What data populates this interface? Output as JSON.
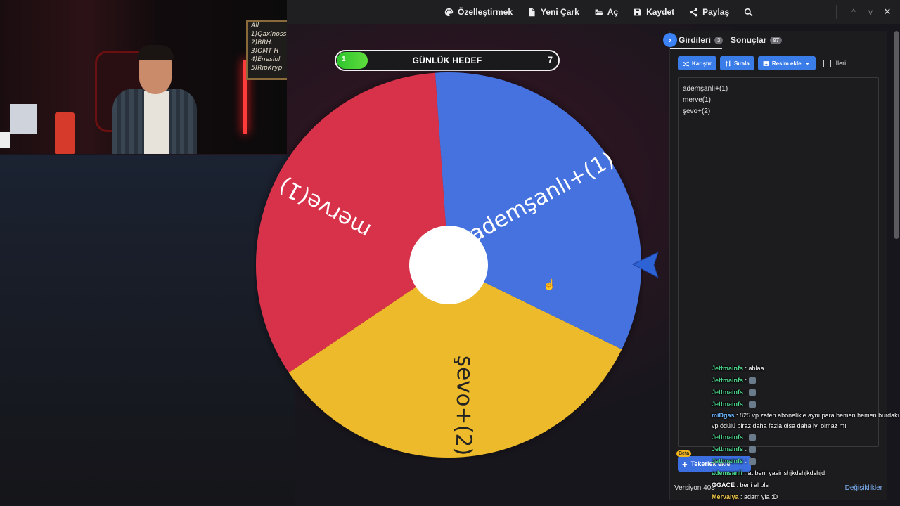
{
  "toolbar": {
    "items": [
      {
        "label": "Özelleştirmek",
        "icon": "palette-icon"
      },
      {
        "label": "Yeni Çark",
        "icon": "file-icon"
      },
      {
        "label": "Aç",
        "icon": "folder-open-icon"
      },
      {
        "label": "Kaydet",
        "icon": "save-icon"
      },
      {
        "label": "Paylaş",
        "icon": "share-icon"
      }
    ],
    "search_icon": "search-icon",
    "window_controls": [
      "^",
      "v",
      "✕"
    ]
  },
  "webcam": {
    "board_lines": [
      "All",
      "1)Qaxinoss",
      "2)BRH...",
      "3)OMT H",
      "4)Eneslol",
      "5)RipKryp"
    ]
  },
  "goal": {
    "current": "1",
    "title": "GÜNLÜK HEDEF",
    "target": "7",
    "progress": 0.14
  },
  "wheel": {
    "segments": [
      {
        "label": "ademşanlı+(1)",
        "color": "#4472df"
      },
      {
        "label": "şevo+(2)",
        "color": "#ecba2a"
      },
      {
        "label": "merve(1)",
        "color": "#d8334c"
      }
    ]
  },
  "panel": {
    "tab_inputs": "Girdileri",
    "tab_inputs_count": "3",
    "tab_results": "Sonuçlar",
    "tab_results_count": "97",
    "btn_shuffle": "Karıştır",
    "btn_sort": "Sırala",
    "btn_add_image": "Resim ekle",
    "checkbox_label": "İleri",
    "entries": [
      "ademşanlı+(1)",
      "merve(1)",
      "şevo+(2)"
    ],
    "beta": "Beta",
    "add_wheel": "Tekerlek ekle",
    "version": "Versiyon 403",
    "changes": "Değişiklikler"
  },
  "chat": [
    {
      "user": "Jettmainfs",
      "color": "#4dd68c",
      "text": "ablaa"
    },
    {
      "user": "Jettmainfs",
      "color": "#4dd68c",
      "text": "",
      "emote": true
    },
    {
      "user": "Jettmainfs",
      "color": "#4dd68c",
      "text": "",
      "emote": true
    },
    {
      "user": "Jettmainfs",
      "color": "#4dd68c",
      "text": "",
      "emote": true
    },
    {
      "user": "miDgas",
      "color": "#6bb6ff",
      "text": "825 vp zaten abonelikle aynı para hemen hemen burdakı vp ödülü biraz daha fazla olsa daha iyi olmaz mı"
    },
    {
      "user": "Jettmainfs",
      "color": "#4dd68c",
      "text": "",
      "emote": true
    },
    {
      "user": "Jettmainfs",
      "color": "#4dd68c",
      "text": "",
      "emote": true
    },
    {
      "user": "Jettmainfs",
      "color": "#4dd68c",
      "text": "",
      "emote": true
    },
    {
      "user": "ademsanli",
      "color": "#4dd68c",
      "text": "at beni yasir shjkdshjkdshjd"
    },
    {
      "user": "GGACE",
      "color": "#ffffff",
      "text": "beni al pls"
    },
    {
      "user": "Mervalya",
      "color": "#f2c94c",
      "text": "adam yia :D"
    }
  ]
}
